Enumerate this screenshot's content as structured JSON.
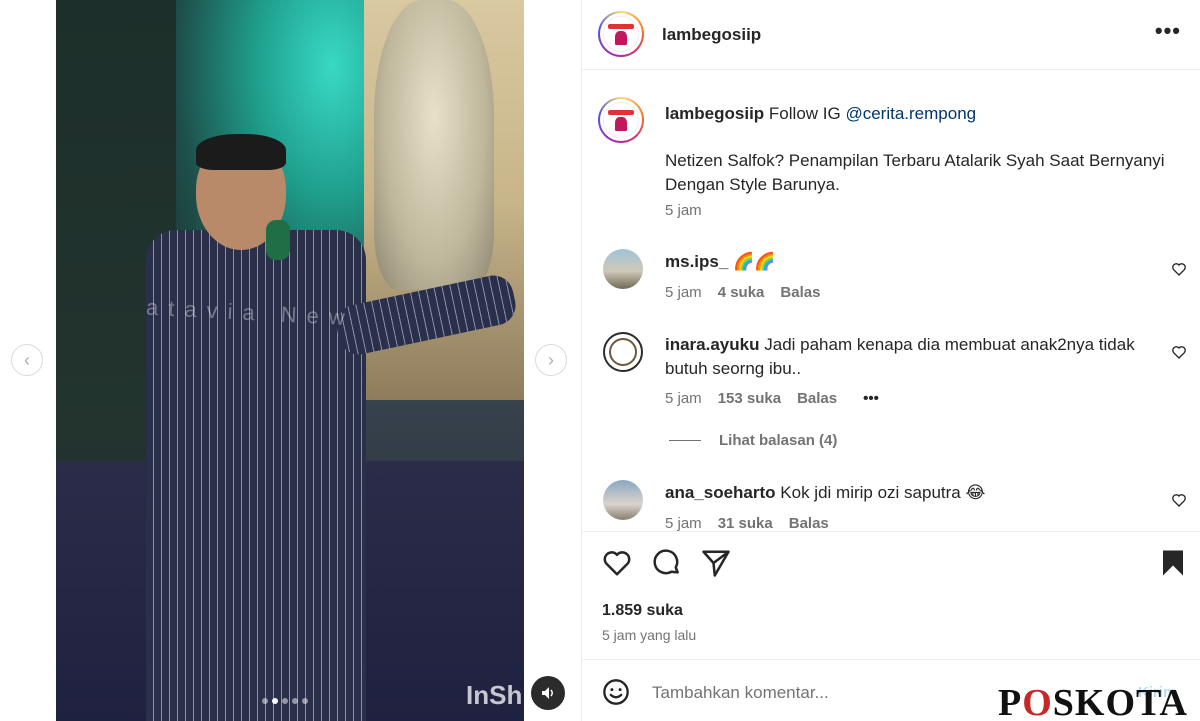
{
  "post": {
    "username": "lambegosiip",
    "more_label": "•••"
  },
  "media": {
    "watermark": "atavia New",
    "brand": "InSh",
    "prev_label": "‹",
    "next_label": "›",
    "dots": [
      false,
      true,
      false,
      false,
      false
    ],
    "sound_icon": "speaker-icon"
  },
  "caption": {
    "user": "lambegosiip",
    "prefix": "Follow IG",
    "mention": "@cerita.rempong",
    "text": "Netizen Salfok? Penampilan Terbaru Atalarik Syah Saat Bernyanyi Dengan Style Barunya.",
    "time": "5 jam"
  },
  "comments": [
    {
      "user": "ms.ips_",
      "text": "🌈🌈",
      "time": "5 jam",
      "likes": "4 suka",
      "reply": "Balas"
    },
    {
      "user": "inara.ayuku",
      "text": "Jadi paham kenapa dia membuat anak2nya tidak butuh seorng ibu..",
      "time": "5 jam",
      "likes": "153 suka",
      "reply": "Balas",
      "more": "•••"
    },
    {
      "user": "ana_soeharto",
      "text": "Kok jdi mirip ozi saputra 😂",
      "time": "5 jam",
      "likes": "31 suka",
      "reply": "Balas"
    }
  ],
  "view_replies": "Lihat balasan (4)",
  "stats": {
    "likes": "1.859 suka",
    "time_ago": "5 jam yang lalu"
  },
  "add_comment": {
    "placeholder": "Tambahkan komentar...",
    "post_label": "Kirim"
  },
  "watermark_brand": {
    "pre": "P",
    "o": "O",
    "post": "SKOTA"
  },
  "colors": {
    "link": "#00376b",
    "muted": "#737373",
    "post_button": "#b2dffc"
  }
}
